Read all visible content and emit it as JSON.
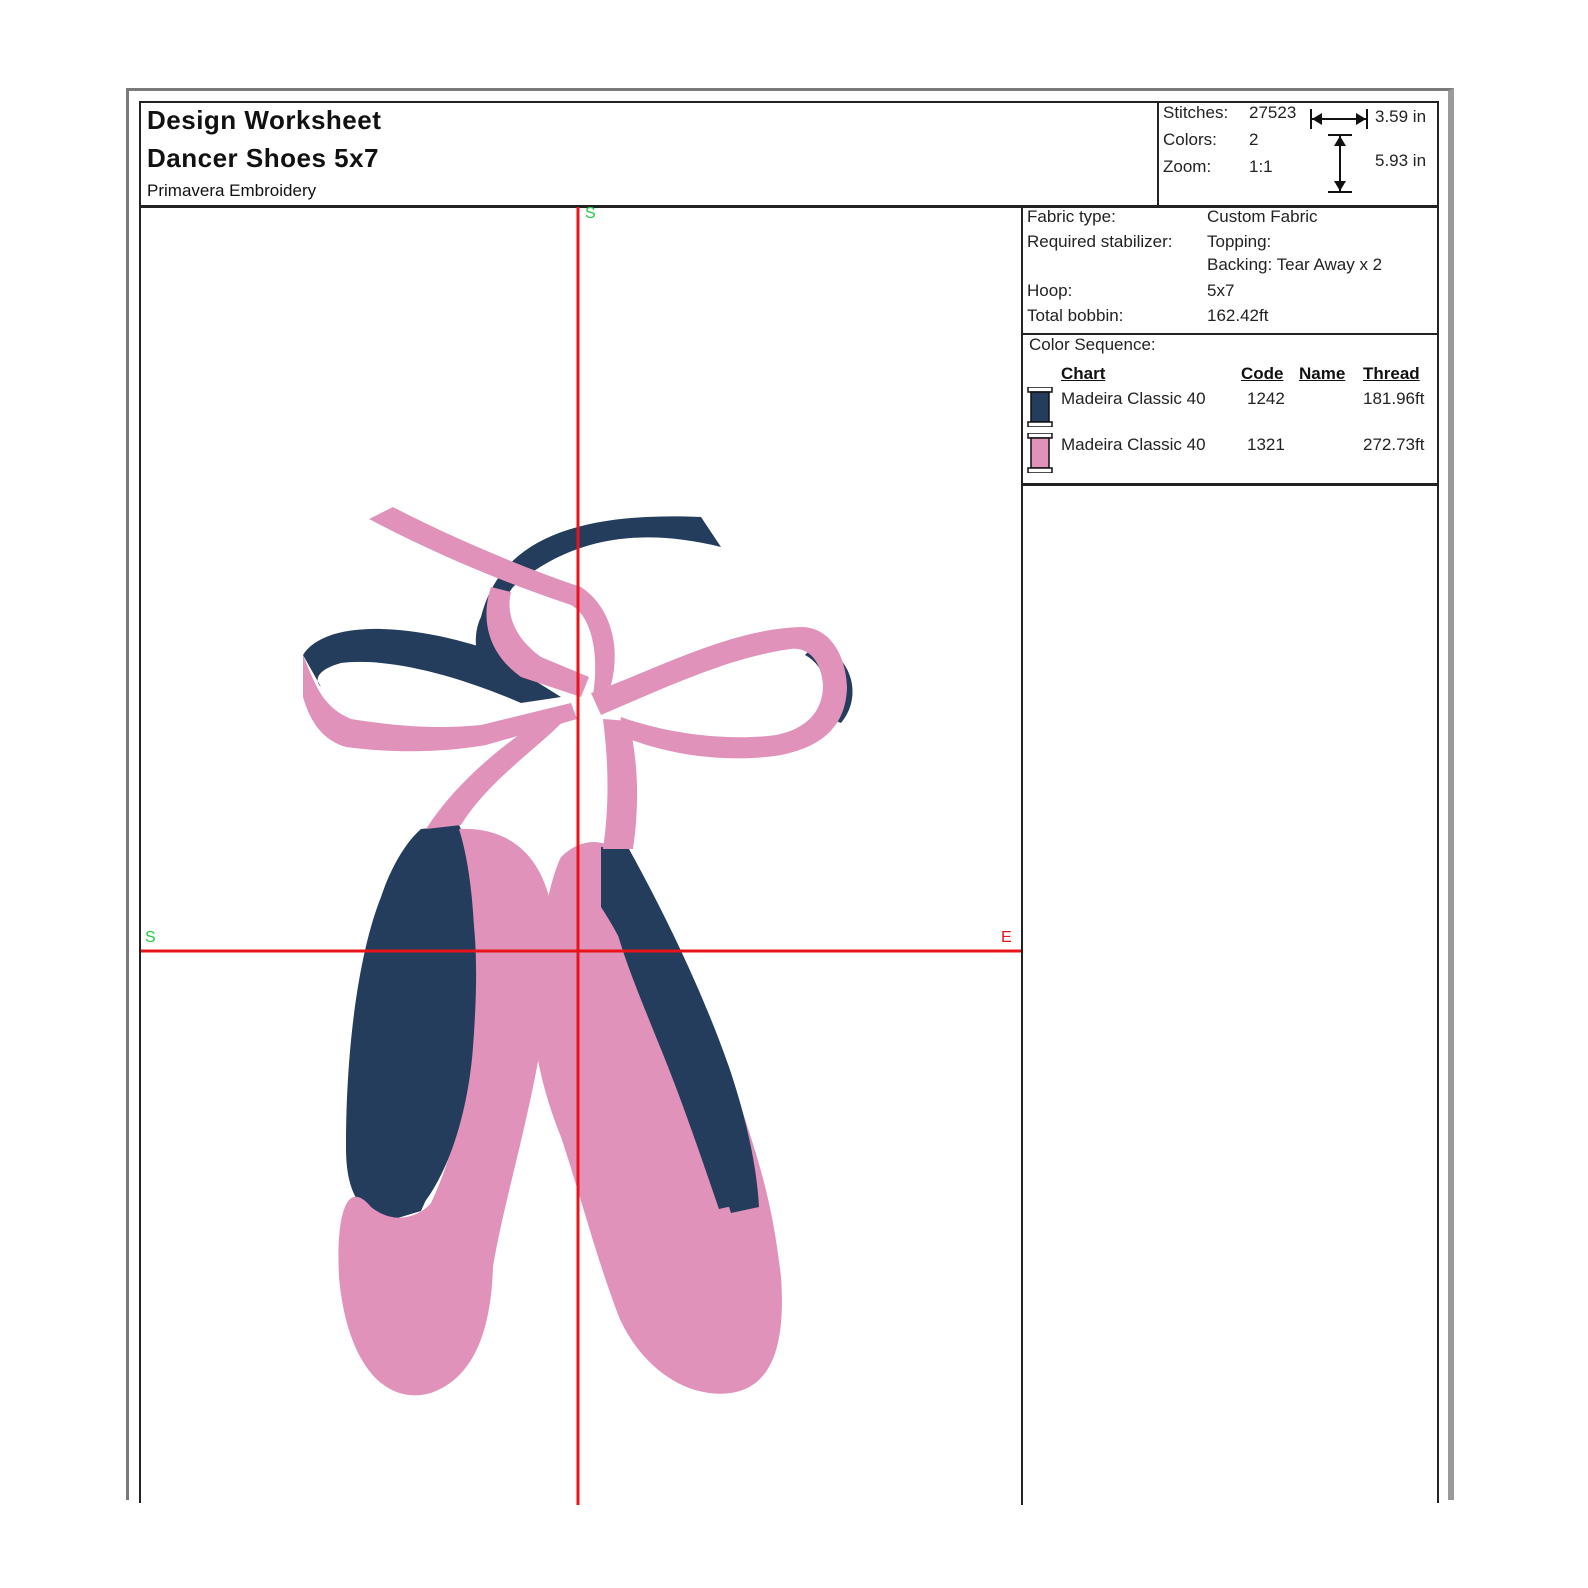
{
  "header": {
    "title": "Design Worksheet",
    "design_name": "Dancer Shoes 5x7",
    "company": "Primavera Embroidery"
  },
  "stats": {
    "stitches_label": "Stitches:",
    "stitches": "27523",
    "colors_label": "Colors:",
    "colors": "2",
    "zoom_label": "Zoom:",
    "zoom": "1:1",
    "width": "3.59 in",
    "height": "5.93 in"
  },
  "axes": {
    "top_marker": "S",
    "left_marker": "S",
    "right_marker": "E",
    "color": "#e8141a"
  },
  "fabric": {
    "fabric_type_label": "Fabric type:",
    "fabric_type": "Custom Fabric",
    "stabilizer_label": "Required stabilizer:",
    "topping": "Topping:",
    "backing": "Backing: Tear Away x 2",
    "hoop_label": "Hoop:",
    "hoop": "5x7",
    "bobbin_label": "Total bobbin:",
    "bobbin": "162.42ft"
  },
  "color_sequence": {
    "title": "Color Sequence:",
    "headers": {
      "chart": "Chart",
      "code": "Code",
      "name": "Name",
      "thread": "Thread"
    },
    "rows": [
      {
        "chart": "Madeira Classic 40",
        "code": "1242",
        "name": "",
        "thread": "181.96ft",
        "color": "#243d5c"
      },
      {
        "chart": "Madeira Classic 40",
        "code": "1321",
        "name": "",
        "thread": "272.73ft",
        "color": "#e192ba"
      }
    ]
  },
  "design_colors": {
    "navy": "#243d5c",
    "pink": "#e192ba"
  }
}
